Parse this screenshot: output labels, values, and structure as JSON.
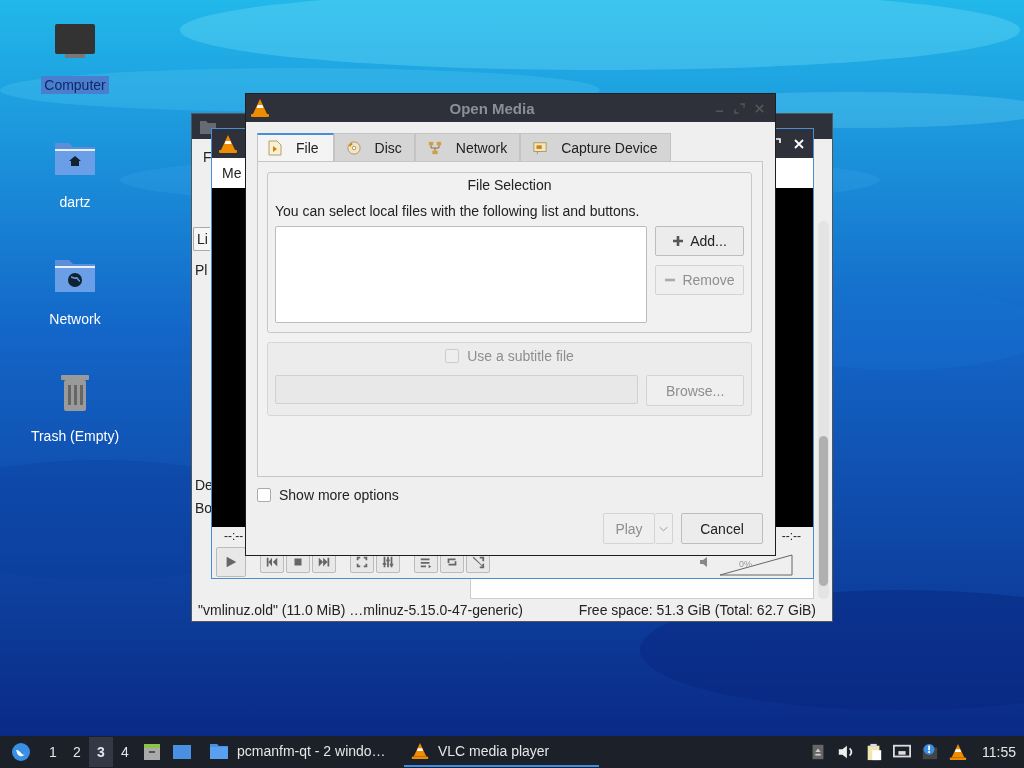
{
  "desktop_icons": [
    {
      "label": "Computer",
      "kind": "computer",
      "selected": true
    },
    {
      "label": "dartz",
      "kind": "home",
      "selected": false
    },
    {
      "label": "Network",
      "kind": "network",
      "selected": false
    },
    {
      "label": "Trash (Empty)",
      "kind": "trash",
      "selected": false
    }
  ],
  "file_manager": {
    "fragments": [
      "F",
      "Pl",
      "De",
      "Bo"
    ],
    "partial_button": "Li",
    "status_left": "\"vmlinuz.old\" (11.0 MiB) …mlinuz-5.15.0-47-generic)",
    "status_right": "Free space: 51.3 GiB (Total: 62.7 GiB)"
  },
  "vlc": {
    "menu": "Me",
    "time_left": "--:--",
    "time_right": "--:--",
    "volume_reading": "0%",
    "volume": {
      "level": 0
    }
  },
  "dialog": {
    "title": "Open Media",
    "tabs": [
      {
        "label": "File",
        "kind": "file",
        "selected": true
      },
      {
        "label": "Disc",
        "kind": "disc",
        "selected": false
      },
      {
        "label": "Network",
        "kind": "network",
        "selected": false
      },
      {
        "label": "Capture Device",
        "kind": "capture",
        "selected": false
      }
    ],
    "group_title": "File Selection",
    "hint": "You can select local files with the following list and buttons.",
    "side_buttons": [
      {
        "label": "Add...",
        "kind": "add",
        "disabled": false
      },
      {
        "label": "Remove",
        "kind": "remove",
        "disabled": true
      }
    ],
    "subtitle": {
      "label": "Use a subtitle file",
      "checked": false,
      "disabled": true,
      "browse": "Browse..."
    },
    "show_more": {
      "label": "Show more options",
      "checked": false
    },
    "play": {
      "label": "Play",
      "disabled": true
    },
    "cancel": "Cancel"
  },
  "taskbar": {
    "workspaces": [
      {
        "label": "1",
        "selected": false
      },
      {
        "label": "2",
        "selected": false
      },
      {
        "label": "3",
        "selected": true
      },
      {
        "label": "4",
        "selected": false
      }
    ],
    "tasks": [
      {
        "label": "pcmanfm-qt - 2 windo…",
        "kind": "folder",
        "selected": false
      },
      {
        "label": "VLC media player",
        "kind": "vlc",
        "selected": true
      }
    ],
    "clock": "11:55"
  }
}
